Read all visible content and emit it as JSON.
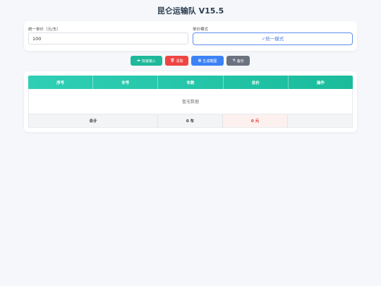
{
  "app": {
    "title": "昆仑运输队 V15.5"
  },
  "settings": {
    "price_label": "统一单价（元/车）",
    "price_value": "100",
    "mode_label": "单价模式",
    "mode_button": "✓统一模式"
  },
  "toolbar": {
    "quick_input": {
      "icon": "truck-icon",
      "glyph": "▬",
      "label": "快速输入",
      "color": "#1fb89a"
    },
    "clear": {
      "icon": "trash-icon",
      "glyph": "🗑",
      "label": "清除",
      "color": "#ef4444"
    },
    "screenshot": {
      "icon": "chart-icon",
      "glyph": "▦",
      "label": "生成截图",
      "color": "#3b82f6"
    },
    "backup": {
      "icon": "flask-icon",
      "glyph": "⚗",
      "label": "备份",
      "color": "#6b7280"
    }
  },
  "table": {
    "headers": [
      "序号",
      "车号",
      "车数",
      "总价",
      "操作"
    ],
    "empty_text": "暂无数据",
    "footer": {
      "label": "合计",
      "trucks": "0 车",
      "total": "0 元"
    }
  }
}
